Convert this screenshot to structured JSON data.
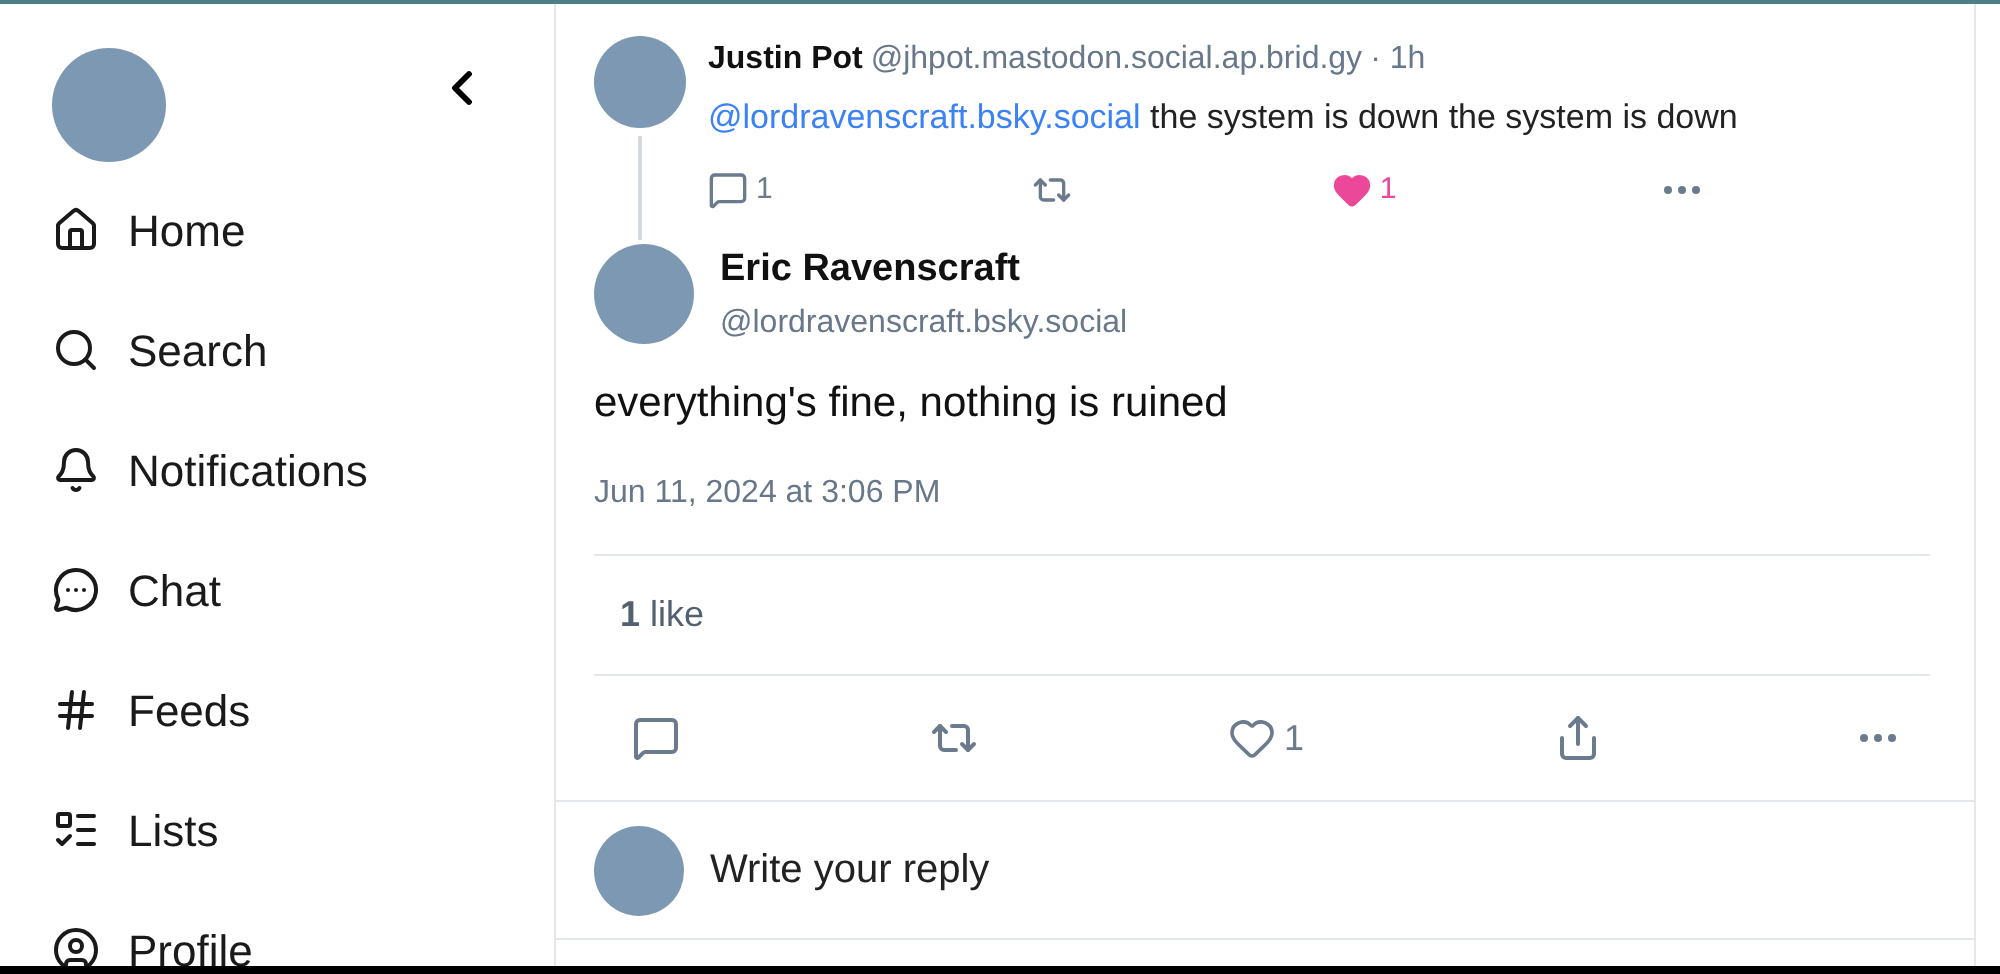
{
  "sidebar": {
    "items": [
      {
        "kind": "home",
        "label": "Home"
      },
      {
        "kind": "search",
        "label": "Search"
      },
      {
        "kind": "bell",
        "label": "Notifications"
      },
      {
        "kind": "chat",
        "label": "Chat"
      },
      {
        "kind": "hash",
        "label": "Feeds"
      },
      {
        "kind": "list",
        "label": "Lists"
      },
      {
        "kind": "profile",
        "label": "Profile"
      }
    ]
  },
  "parent_post": {
    "author": "Justin Pot",
    "handle": "@jhpot.mastodon.social.ap.brid.gy",
    "time": "· 1h",
    "mention": "@lordravenscraft.bsky.social",
    "text": "the system is down the system is down",
    "replies": "1",
    "likes": "1",
    "liked": true
  },
  "main_post": {
    "author": "Eric Ravenscraft",
    "handle": "@lordravenscraft.bsky.social",
    "text": "everything's fine, nothing is ruined",
    "date": "Jun 11, 2024 at 3:06 PM",
    "like_summary": "**1** like",
    "likes": "1",
    "liked": false
  },
  "reply_box": {
    "placeholder": "Write your reply"
  }
}
